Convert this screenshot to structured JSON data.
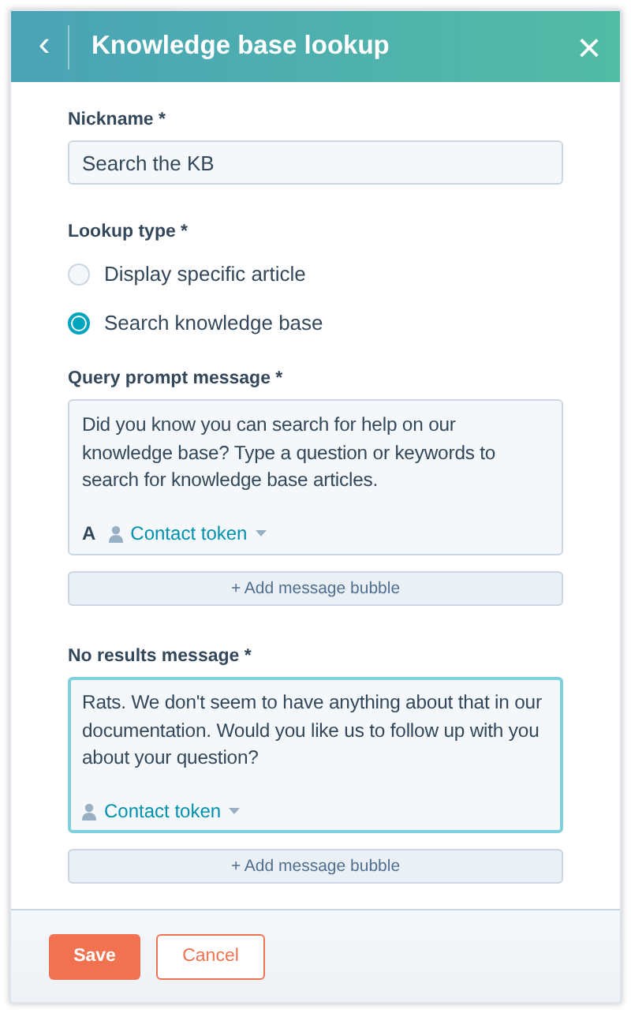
{
  "header": {
    "back": "‹",
    "title": "Knowledge base lookup",
    "close": "×"
  },
  "nickname": {
    "label": "Nickname *",
    "value": "Search the KB"
  },
  "lookup_type": {
    "label": "Lookup type *",
    "options": [
      {
        "label": "Display specific article",
        "selected": false
      },
      {
        "label": "Search knowledge base",
        "selected": true
      }
    ]
  },
  "messages": [
    {
      "label": "Query prompt message *",
      "text": "Did you know you can search for help on our knowledge base? Type a question or keywords to search for knowledge base articles.",
      "focused": false,
      "format_glyph": "A",
      "token": "Contact token",
      "add_button": "+ Add message bubble"
    },
    {
      "label": "No results message *",
      "text": "Rats. We don't seem to have anything about that in our documentation. Would you like us to follow up with you about your question?",
      "focused": true,
      "token": "Contact token",
      "add_button": "+ Add message bubble"
    }
  ],
  "footer": {
    "save": "Save",
    "cancel": "Cancel"
  }
}
